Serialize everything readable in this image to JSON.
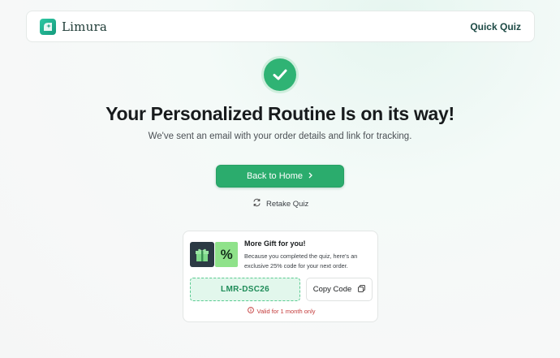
{
  "header": {
    "brand_name": "Limura",
    "brand_icon": "limura-logo-icon",
    "quiz_link": "Quick Quiz"
  },
  "hero": {
    "status_icon": "check-icon",
    "title": "Your Personalized Routine Is on its way!",
    "subtitle": "We've sent an email with your order details and link for tracking."
  },
  "actions": {
    "home_button": "Back to Home",
    "home_button_icon": "chevron-right-icon",
    "retake_label": "Retake Quiz",
    "retake_icon": "refresh-icon"
  },
  "gift": {
    "title": "More Gift for you!",
    "description": "Because you completed the quiz, here's an exclusive 25% code for your next order.",
    "art_icons": [
      "gift-icon",
      "percent-icon"
    ],
    "percent_symbol": "%",
    "code": "LMR-DSC26",
    "copy_label": "Copy Code",
    "copy_icon": "copy-icon",
    "validity": "Valid for 1 month only",
    "validity_icon": "info-icon"
  },
  "colors": {
    "primary_green": "#2bac6d",
    "code_text": "#1f8c59",
    "warning_red": "#c33a3a"
  }
}
